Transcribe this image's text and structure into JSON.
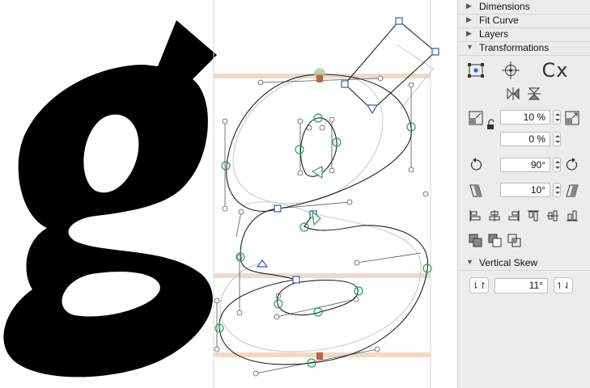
{
  "panel": {
    "sections": {
      "dimensions": "Dimensions",
      "fit_curve": "Fit Curve",
      "layers": "Layers",
      "transformations": "Transformations",
      "vertical_skew": "Vertical Skew"
    },
    "transform_fields": {
      "scale_width": "10 %",
      "scale_height": "0 %",
      "rotate": "90°",
      "slant": "10°"
    },
    "vertical_skew_value": "11°",
    "origin_label": "Cx"
  },
  "colors": {
    "accent_point": "#1a6ef0",
    "smooth_node": "#23a35a",
    "corner_node": "#2f5cb8",
    "metric_line": "#f0d9c6"
  }
}
